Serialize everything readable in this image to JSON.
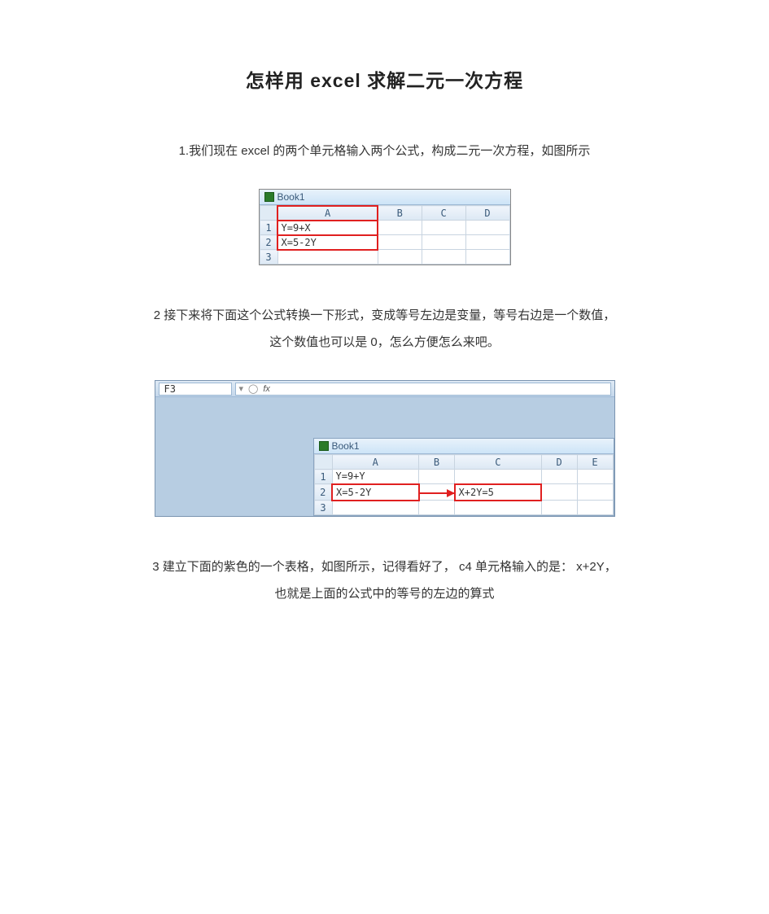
{
  "title": "怎样用 excel 求解二元一次方程",
  "step1": "1.我们现在 excel 的两个单元格输入两个公式，构成二元一次方程，如图所示",
  "step2a": "2 接下来将下面这个公式转换一下形式，变成等号左边是变量，等号右边是一个数值，",
  "step2b": "这个数值也可以是 0，怎么方便怎么来吧。",
  "step3a": "3 建立下面的紫色的一个表格，如图所示，记得看好了， c4 单元格输入的是： x+2Y，",
  "step3b": "也就是上面的公式中的等号的左边的算式",
  "fig1": {
    "book": "Book1",
    "cols": [
      "A",
      "B",
      "C",
      "D"
    ],
    "rows": [
      "1",
      "2",
      "3"
    ],
    "a1": "Y=9+X",
    "a2": "X=5-2Y"
  },
  "fig2": {
    "namebox": "F3",
    "book": "Book1",
    "cols": [
      "A",
      "B",
      "C",
      "D",
      "E"
    ],
    "rows": [
      "1",
      "2",
      "3"
    ],
    "a1": "Y=9+Y",
    "a2": "X=5-2Y",
    "c2": "X+2Y=5"
  }
}
